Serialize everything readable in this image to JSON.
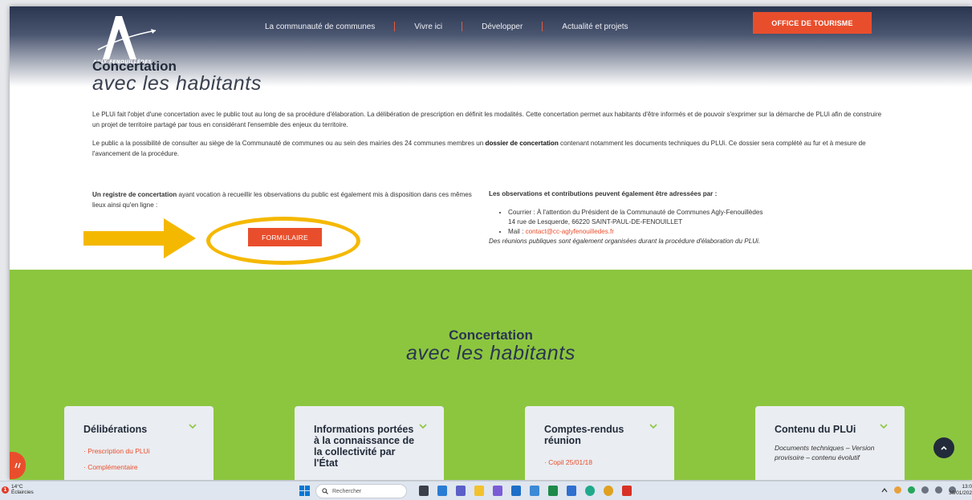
{
  "header": {
    "logo_text": "AGLY·FENOUILLÈDES",
    "nav": [
      {
        "label": "La communauté de communes"
      },
      {
        "label": "Vivre ici"
      },
      {
        "label": "Développer"
      },
      {
        "label": "Actualité et projets"
      }
    ],
    "cta_label": "OFFICE DE TOURISME"
  },
  "section": {
    "title_bold": "Concertation",
    "title_italic": "avec les habitants",
    "para1": "Le PLUi fait l'objet d'une concertation avec le public tout au long de sa procédure d'élaboration. La délibération de prescription en définit les modalités. Cette concertation permet aux habitants d'être informés et de pouvoir s'exprimer sur la démarche de PLUi afin de construire un projet de territoire partagé par tous en considérant l'ensemble des enjeux du territoire.",
    "para2_a": "Le public a la possibilité de consulter au siège de la Communauté de communes ou au sein des mairies des 24 communes membres un ",
    "para2_bold": "dossier de concertation",
    "para2_b": " contenant notamment les documents techniques du PLUi. Ce dossier sera complété au fur et à mesure de l'avancement de la procédure.",
    "left_bold": "Un registre de concertation",
    "left_text": " ayant vocation à recueillir les observations du public est également mis à disposition dans ces mêmes lieux ainsi qu'en ligne :",
    "form_button": "FORMULAIRE",
    "right_heading": "Les observations et contributions peuvent également être adressées par :",
    "courrier_line1": "Courrier : À l'attention du Président de la Communauté de Communes Agly-Fenouillèdes",
    "courrier_line2": "14 rue de Lesquerde, 66220 SAINT-PAUL-DE-FENOUILLET",
    "mail_label": "Mail : ",
    "mail_link": "contact@cc-aglyfenouilledes.fr",
    "reunions": "Des réunions publiques sont également organisées durant la procédure d'élaboration du PLUi."
  },
  "green_section": {
    "title_bold": "Concertation",
    "title_italic": "avec les habitants",
    "cards": [
      {
        "title": "Délibérations",
        "links": [
          "· Prescription du PLUi",
          "· Complémentaire"
        ]
      },
      {
        "title": "Informations portées à la connaissance de la collectivité par l'État",
        "links": []
      },
      {
        "title": "Comptes-rendus réunion",
        "links": [
          "· Copil 25/01/18"
        ]
      },
      {
        "title": "Contenu du PLUi",
        "italic": "Documents techniques – Version provisoire – contenu évolutif"
      }
    ]
  },
  "taskbar": {
    "weather_temp": "14°C",
    "weather_desc": "Éclaircies",
    "search_placeholder": "Rechercher",
    "time": "13:0",
    "date": "30/01/202"
  },
  "colors": {
    "accent": "#e94e2c",
    "green": "#8cc63f",
    "navy": "#222b3a",
    "highlight": "#f5b800"
  }
}
